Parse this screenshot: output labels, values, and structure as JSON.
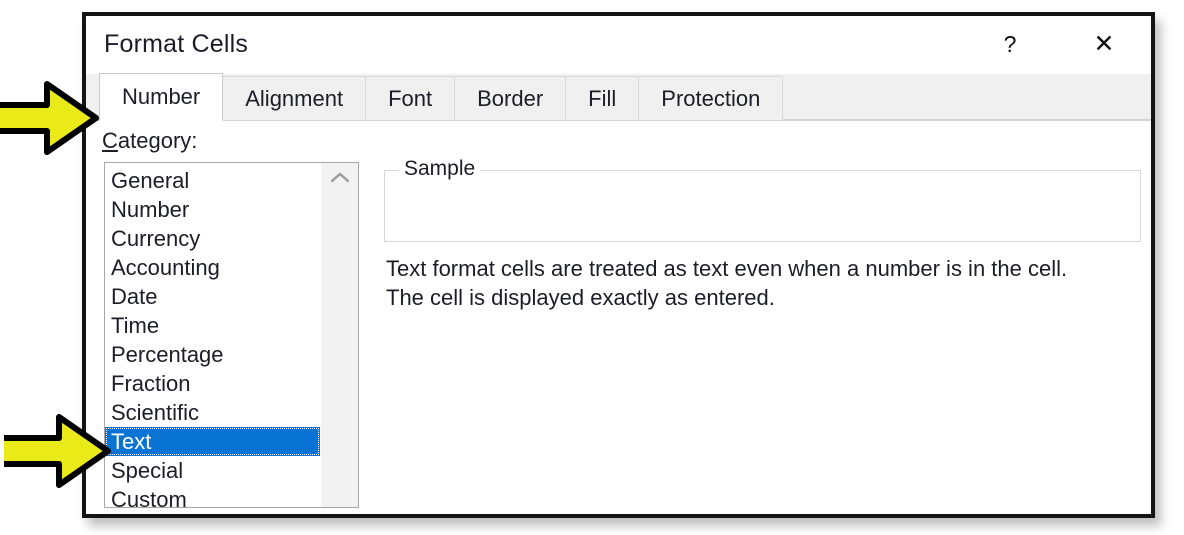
{
  "dialog": {
    "title": "Format Cells",
    "help_label": "?",
    "close_label": "✕"
  },
  "tabs": [
    {
      "label": "Number",
      "active": true
    },
    {
      "label": "Alignment",
      "active": false
    },
    {
      "label": "Font",
      "active": false
    },
    {
      "label": "Border",
      "active": false
    },
    {
      "label": "Fill",
      "active": false
    },
    {
      "label": "Protection",
      "active": false
    }
  ],
  "category": {
    "label_prefix": "C",
    "label_rest": "ategory:",
    "items": [
      "General",
      "Number",
      "Currency",
      "Accounting",
      "Date",
      "Time",
      "Percentage",
      "Fraction",
      "Scientific",
      "Text",
      "Special",
      "Custom"
    ],
    "selected": "Text"
  },
  "sample": {
    "legend": "Sample",
    "value": ""
  },
  "description": {
    "line1": "Text format cells are treated as text even when a number is in the cell.",
    "line2": "The cell is displayed exactly as entered."
  },
  "annotations": [
    {
      "name": "arrow-pointing-to-number-tab",
      "target": "Number"
    },
    {
      "name": "arrow-pointing-to-text-category",
      "target": "Text"
    }
  ],
  "colors": {
    "selection_blue": "#0a74d4",
    "annotation_yellow": "#eaea18",
    "annotation_outline": "#000000",
    "tab_strip": "#f0f0f0",
    "dialog_border": "#141414"
  }
}
